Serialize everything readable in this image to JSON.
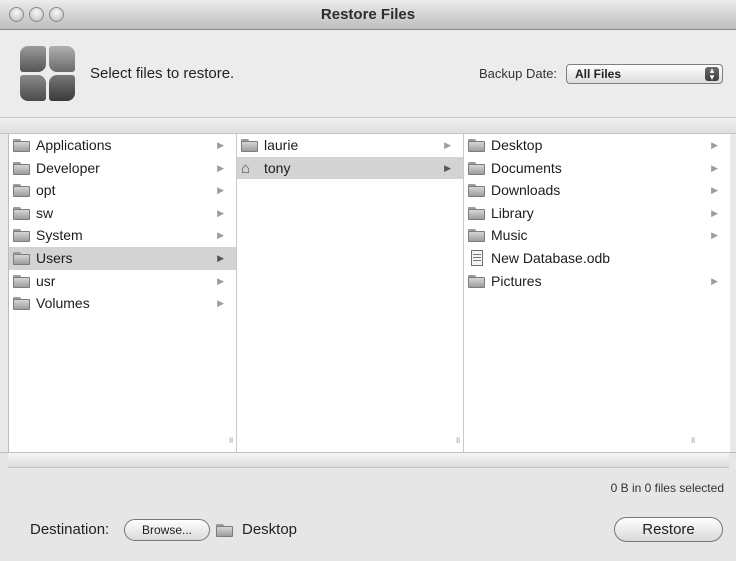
{
  "window": {
    "title": "Restore Files"
  },
  "header": {
    "instruction": "Select files to restore.",
    "backup_date_label": "Backup Date:",
    "backup_date_value": "All Files"
  },
  "browser": {
    "column1": [
      {
        "label": "Applications",
        "icon": "folder-icon",
        "has_children": true,
        "selected": false
      },
      {
        "label": "Developer",
        "icon": "folder-icon",
        "has_children": true,
        "selected": false
      },
      {
        "label": "opt",
        "icon": "folder-icon",
        "has_children": true,
        "selected": false
      },
      {
        "label": "sw",
        "icon": "folder-icon",
        "has_children": true,
        "selected": false
      },
      {
        "label": "System",
        "icon": "folder-icon",
        "has_children": true,
        "selected": false
      },
      {
        "label": "Users",
        "icon": "folder-icon",
        "has_children": true,
        "selected": true
      },
      {
        "label": "usr",
        "icon": "folder-icon",
        "has_children": true,
        "selected": false
      },
      {
        "label": "Volumes",
        "icon": "folder-icon",
        "has_children": true,
        "selected": false
      }
    ],
    "column2": [
      {
        "label": "laurie",
        "icon": "folder-icon",
        "has_children": true,
        "selected": false
      },
      {
        "label": "tony",
        "icon": "home-icon",
        "has_children": true,
        "selected": true
      }
    ],
    "column3": [
      {
        "label": "Desktop",
        "icon": "folder-icon",
        "has_children": true,
        "selected": false
      },
      {
        "label": "Documents",
        "icon": "folder-icon",
        "has_children": true,
        "selected": false
      },
      {
        "label": "Downloads",
        "icon": "folder-icon",
        "has_children": true,
        "selected": false
      },
      {
        "label": "Library",
        "icon": "folder-icon",
        "has_children": true,
        "selected": false
      },
      {
        "label": "Music",
        "icon": "folder-icon",
        "has_children": true,
        "selected": false
      },
      {
        "label": "New Database.odb",
        "icon": "document-icon",
        "has_children": false,
        "selected": false
      },
      {
        "label": "Pictures",
        "icon": "folder-icon",
        "has_children": true,
        "selected": false
      }
    ]
  },
  "footer": {
    "selection_status": "0 B in 0 files selected",
    "destination_label": "Destination:",
    "browse_label": "Browse...",
    "destination_folder": "Desktop",
    "restore_label": "Restore"
  },
  "colors": {
    "selected_row": "#d3d3d3",
    "window_bg": "#e9e9e9"
  }
}
